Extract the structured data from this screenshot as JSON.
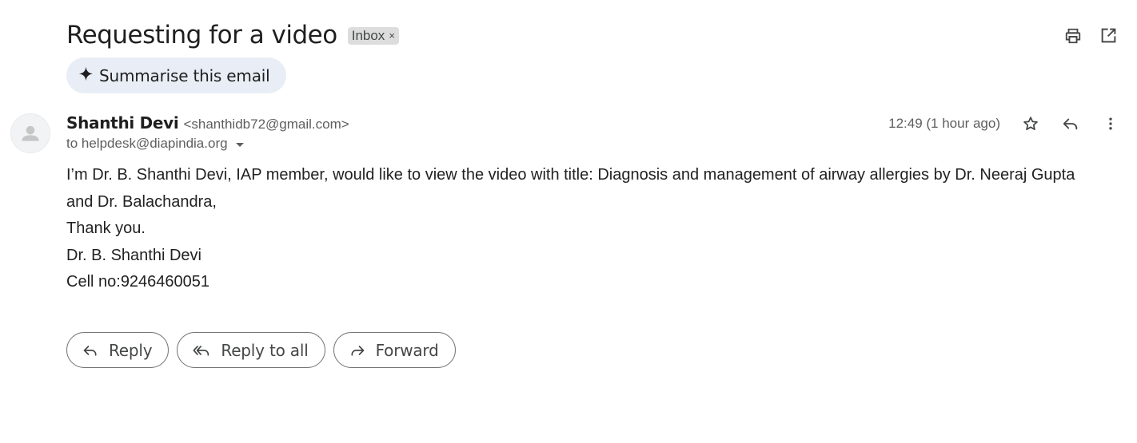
{
  "email": {
    "subject": "Requesting for a video",
    "label": "Inbox",
    "label_remove": "×",
    "summarise_label": "Summarise this email",
    "sender": {
      "name": "Shanthi Devi",
      "email": "<shanthidb72@gmail.com>"
    },
    "to_line": "to helpdesk@diapindia.org",
    "timestamp": "12:49 (1 hour ago)",
    "body": {
      "line1": "I’m Dr. B. Shanthi Devi, IAP member, would like to view the video with title: Diagnosis and management of airway allergies by Dr. Neeraj Gupta and Dr. Balachandra,",
      "line2": "Thank you.",
      "line3": "Dr. B. Shanthi Devi",
      "line4": "Cell no:9246460051"
    }
  },
  "actions": {
    "reply": "Reply",
    "reply_all": "Reply to all",
    "forward": "Forward"
  },
  "icons": {
    "print": "print-icon",
    "open_new_window": "open-in-new-window-icon",
    "sparkle": "sparkle-icon",
    "avatar": "default-avatar-icon",
    "star": "star-icon",
    "reply": "reply-icon",
    "more": "more-vert-icon",
    "reply_all": "reply-all-icon",
    "forward": "forward-icon"
  },
  "colors": {
    "summarise_bg": "#e9eef6",
    "label_bg": "#dddddd",
    "text_secondary": "#5e5e5e",
    "button_border": "#747775"
  }
}
